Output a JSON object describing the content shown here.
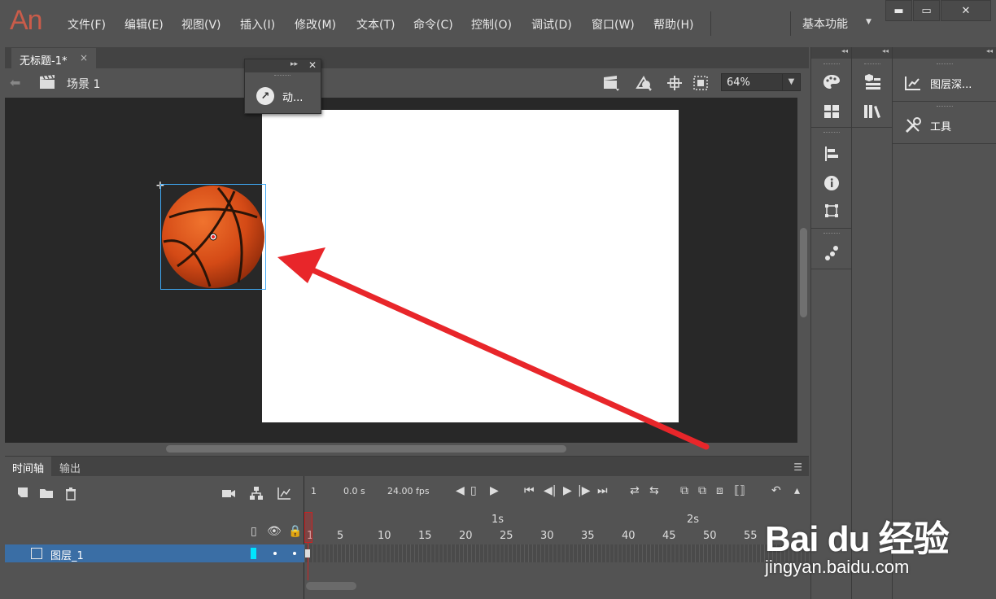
{
  "app": {
    "logo": "An"
  },
  "menu": [
    "文件(F)",
    "编辑(E)",
    "视图(V)",
    "插入(I)",
    "修改(M)",
    "文本(T)",
    "命令(C)",
    "控制(O)",
    "调试(D)",
    "窗口(W)",
    "帮助(H)"
  ],
  "workspace": {
    "label": "基本功能"
  },
  "window_controls": {
    "minimize": "▬",
    "maximize": "▭",
    "close": "✕"
  },
  "document": {
    "tab_label": "无标题-1*",
    "tab_close": "×",
    "scene_label": "场景 1"
  },
  "zoom": {
    "value": "64%"
  },
  "float_panel": {
    "item_label": "动..."
  },
  "dock": {
    "panel_items": [
      "图层深...",
      "工具"
    ]
  },
  "timeline": {
    "tabs": [
      "时间轴",
      "输出"
    ],
    "current_frame": "1",
    "elapsed": "0.0",
    "elapsed_unit": "s",
    "fps_value": "24.00",
    "fps_unit": "fps",
    "ruler_numbers": [
      "1",
      "5",
      "10",
      "15",
      "20",
      "25",
      "30",
      "35",
      "40",
      "45",
      "50",
      "55"
    ],
    "ruler_seconds": [
      "1s",
      "2s"
    ],
    "layer_name": "图层_1"
  },
  "watermark": {
    "logo": "Bai du 经验",
    "sub": "jingyan.baidu.com"
  },
  "colors": {
    "accent_layer": "#3a6ea5",
    "arrow": "#e8262a",
    "selection": "#3fa9f5",
    "layer_tag": "#00e5ff"
  }
}
